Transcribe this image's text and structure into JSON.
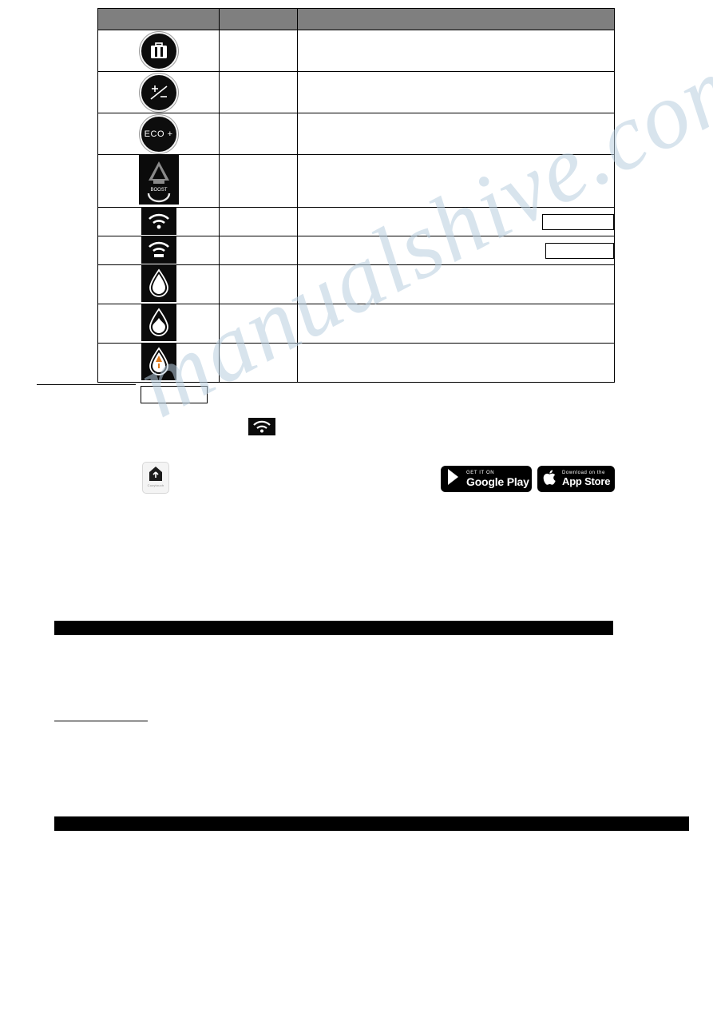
{
  "document": {
    "table": {
      "headers": [
        "",
        "",
        ""
      ],
      "rows": [
        {
          "icon": "suitcase-icon",
          "name": "",
          "desc": "",
          "has_box": false
        },
        {
          "icon": "plus-minus-icon",
          "name": "",
          "desc": "",
          "has_box": false
        },
        {
          "icon": "eco-plus-icon",
          "name": "",
          "desc": "",
          "has_box": false
        },
        {
          "icon": "boost-icon",
          "name": "",
          "desc": "",
          "has_box": false
        },
        {
          "icon": "wifi-signal-icon",
          "name": "",
          "desc": "",
          "has_box": true
        },
        {
          "icon": "wifi-device-icon",
          "name": "",
          "desc": "",
          "has_box": true
        },
        {
          "icon": "water-drop-full-icon",
          "name": "",
          "desc": "",
          "has_box": false
        },
        {
          "icon": "water-drop-half-icon",
          "name": "",
          "desc": "",
          "has_box": false
        },
        {
          "icon": "water-drop-alert-icon",
          "name": "",
          "desc": "",
          "has_box": false
        }
      ]
    },
    "section_notes": {
      "note_box": "",
      "wifi_inline_icon": "wifi-icon",
      "app_icon_label": "Cozytouch"
    },
    "store_badges": {
      "google": {
        "top_text": "GET IT ON",
        "main_text": "Google Play",
        "icon": "google-play-icon"
      },
      "apple": {
        "top_text": "Download on the",
        "main_text": "App Store",
        "icon": "apple-logo-icon"
      }
    },
    "black_bars": [
      {
        "text": ""
      },
      {
        "text": ""
      }
    ]
  },
  "watermark": {
    "text": "manualshive.com"
  }
}
